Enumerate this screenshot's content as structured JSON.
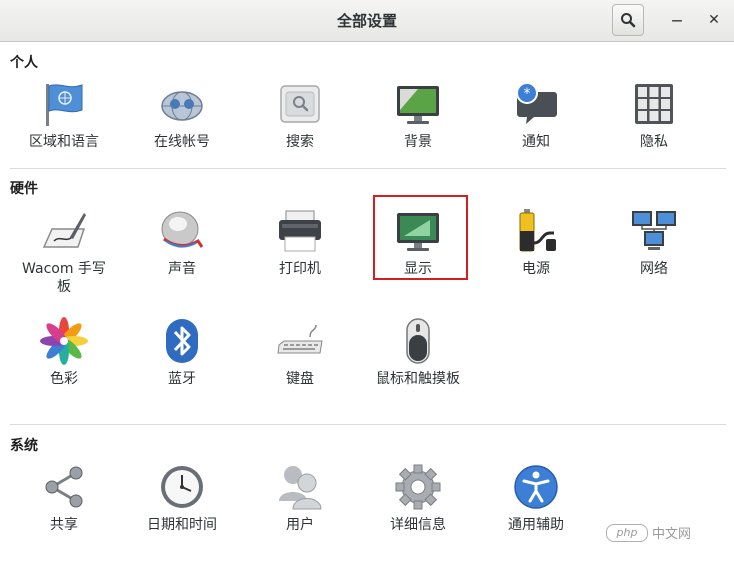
{
  "window": {
    "title": "全部设置",
    "buttons": {
      "search": "search-icon",
      "minimize": "—",
      "close": "✕"
    }
  },
  "sections": {
    "personal": {
      "title": "个人",
      "items": [
        {
          "label": "区域和语言",
          "icon": "flag-globe-icon"
        },
        {
          "label": "在线帐号",
          "icon": "online-accounts-icon"
        },
        {
          "label": "搜索",
          "icon": "search-settings-icon"
        },
        {
          "label": "背景",
          "icon": "background-monitor-icon"
        },
        {
          "label": "通知",
          "icon": "notification-bubble-icon"
        },
        {
          "label": "隐私",
          "icon": "privacy-lock-icon"
        }
      ]
    },
    "hardware": {
      "title": "硬件",
      "items": [
        {
          "label": "Wacom 手写板",
          "icon": "wacom-tablet-icon"
        },
        {
          "label": "声音",
          "icon": "speaker-icon"
        },
        {
          "label": "打印机",
          "icon": "printer-icon"
        },
        {
          "label": "显示",
          "icon": "display-monitor-icon",
          "selected": true
        },
        {
          "label": "电源",
          "icon": "battery-power-icon"
        },
        {
          "label": "网络",
          "icon": "network-icon"
        },
        {
          "label": "色彩",
          "icon": "color-flower-icon"
        },
        {
          "label": "蓝牙",
          "icon": "bluetooth-icon"
        },
        {
          "label": "键盘",
          "icon": "keyboard-icon"
        },
        {
          "label": "鼠标和触摸板",
          "icon": "mouse-icon"
        }
      ]
    },
    "system": {
      "title": "系统",
      "items": [
        {
          "label": "共享",
          "icon": "share-icon"
        },
        {
          "label": "日期和时间",
          "icon": "clock-icon"
        },
        {
          "label": "用户",
          "icon": "users-icon"
        },
        {
          "label": "详细信息",
          "icon": "gear-details-icon"
        },
        {
          "label": "通用辅助",
          "icon": "accessibility-icon"
        }
      ]
    }
  },
  "watermark": {
    "logo": "php",
    "text": "中文网"
  },
  "colors": {
    "selection_border": "#d22020",
    "accent_blue": "#3d7ed6",
    "green": "#4a9a3a"
  }
}
